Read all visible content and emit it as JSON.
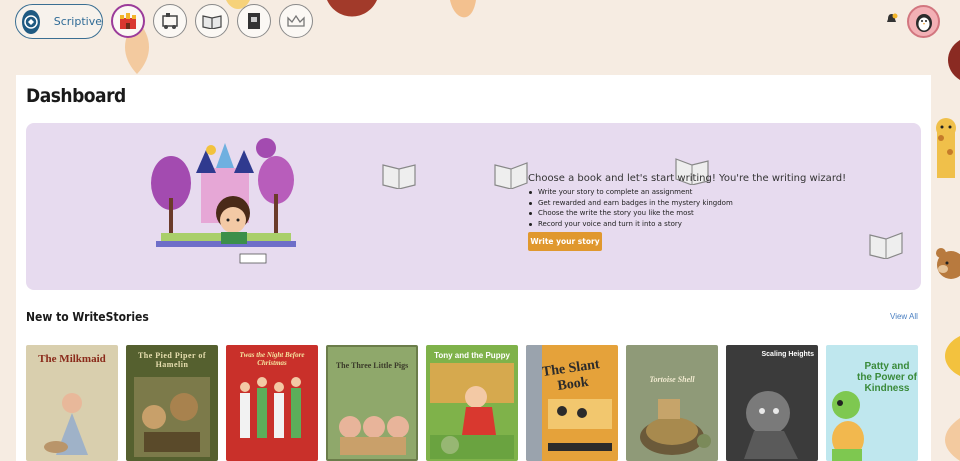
{
  "brand": {
    "name": "Scriptive"
  },
  "nav": {
    "icons": [
      "castle-icon",
      "train-icon",
      "open-book-icon",
      "book-icon",
      "crown-icon"
    ]
  },
  "header": {
    "notification_icon": "bell-icon",
    "avatar_icon": "penguin-icon"
  },
  "page": {
    "title": "Dashboard"
  },
  "hero": {
    "heading": "Choose a book and let's start writing! You're the writing wizard!",
    "bullets": [
      "Write your story to complete an assignment",
      "Get rewarded and earn badges in the mystery kingdom",
      "Choose the write the story you like the most",
      "Record your voice and turn it into a story"
    ],
    "cta_label": "Write your story"
  },
  "section": {
    "title": "New to WriteStories",
    "view_all_label": "View All"
  },
  "books": [
    {
      "title": "The Milkmaid",
      "cover": "#d9cfae"
    },
    {
      "title": "The Pied Piper of Hamelin",
      "cover": "#55602f"
    },
    {
      "title": "Twas the Night Before Christmas",
      "cover": "#c9302a"
    },
    {
      "title": "The Three Little Pigs",
      "cover": "#8fa86b"
    },
    {
      "title": "Tony and the Puppy",
      "cover": "#7fb24a"
    },
    {
      "title": "The Slant Book",
      "cover": "#e5a23a"
    },
    {
      "title": "Tortoise Shell",
      "cover": "#8f9a78"
    },
    {
      "title": "Scaling Heights",
      "cover": "#3b3b3b"
    },
    {
      "title": "Patty and the Power of Kindness",
      "cover": "#bfe7ee"
    }
  ],
  "colors": {
    "accent": "#e0982e",
    "hero_bg": "#e7dbef",
    "link": "#4a7fc1"
  }
}
